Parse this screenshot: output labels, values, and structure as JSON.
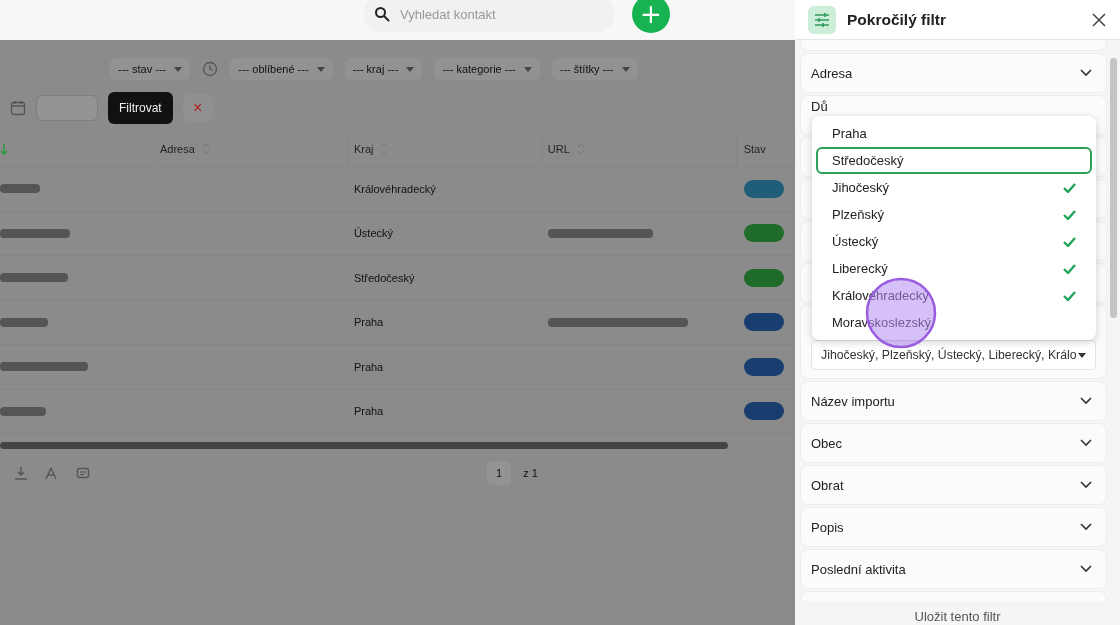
{
  "top_bar": {
    "search": {
      "placeholder": "Vyhledat kontakt"
    },
    "add_button": "+"
  },
  "background": {
    "filters": [
      "--- stav ---",
      "--- oblíbené ---",
      "--- kraj ---",
      "--- kategorie ---",
      "--- štítky ---"
    ],
    "filter_button": "Filtrovat",
    "clear_button": "×",
    "columns": [
      "Adresa",
      "Kraj",
      "URL",
      "Stav"
    ],
    "rows": [
      {
        "kraj": "Královéhradecký",
        "color": "#1f5d78"
      },
      {
        "kraj": "Ústecký",
        "color": "#1f6b2a"
      },
      {
        "kraj": "Středočeský",
        "color": "#1f6b2a"
      },
      {
        "kraj": "Praha",
        "color": "#1a3d70"
      },
      {
        "kraj": "Praha",
        "color": "#1a3d70"
      },
      {
        "kraj": "Praha",
        "color": "#1a3d70"
      }
    ],
    "pagination": {
      "page": "1",
      "total": "z 1"
    }
  },
  "panel": {
    "title": "Pokročilý filtr",
    "sections_before": [
      "Adresa",
      "Dů"
    ],
    "kraj_select": {
      "value": "Jihočeský, Plzeňský, Ústecký, Liberecký, Králo",
      "options": [
        {
          "label": "Praha",
          "selected": false,
          "focused": false
        },
        {
          "label": "Středočeský",
          "selected": false,
          "focused": true
        },
        {
          "label": "Jihočeský",
          "selected": true,
          "focused": false
        },
        {
          "label": "Plzeňský",
          "selected": true,
          "focused": false
        },
        {
          "label": "Ústecký",
          "selected": true,
          "focused": false
        },
        {
          "label": "Liberecký",
          "selected": true,
          "focused": false
        },
        {
          "label": "Královéhradecký",
          "selected": true,
          "focused": false
        },
        {
          "label": "Moravskoslezský",
          "selected": false,
          "focused": false
        }
      ]
    },
    "sections_after": [
      "Název importu",
      "Obec",
      "Obrat",
      "Popis",
      "Poslední aktivita"
    ],
    "save_button": "Uložit tento filtr"
  }
}
